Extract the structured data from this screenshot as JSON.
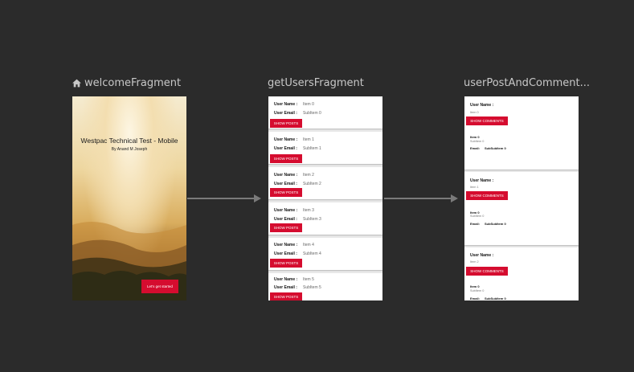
{
  "fragments": [
    {
      "title": "welcomeFragment"
    },
    {
      "title": "getUsersFragment"
    },
    {
      "title": "userPostAndComment..."
    }
  ],
  "welcome": {
    "title": "Westpac Technical Test - Mobile",
    "subtitle": "By Anand M Joseph",
    "button": "Let's get started"
  },
  "users": {
    "name_label": "User Name :",
    "email_label": "User Email :",
    "button": "SHOW POSTS",
    "items": [
      {
        "name": "Item 0",
        "email": "SubItem 0"
      },
      {
        "name": "Item 1",
        "email": "SubItem 1"
      },
      {
        "name": "Item 2",
        "email": "SubItem 2"
      },
      {
        "name": "Item 3",
        "email": "SubItem 3"
      },
      {
        "name": "Item 4",
        "email": "SubItem 4"
      },
      {
        "name": "Item 5",
        "email": "SubItem 5"
      }
    ]
  },
  "posts": {
    "name_label": "User Name :",
    "button": "SHOW COMMENTS",
    "email_label": "Email:",
    "items": [
      {
        "user": "Item 0",
        "title": "Item 0",
        "sub": "SubItem 0",
        "email": "SubSubItem 0"
      },
      {
        "user": "Item 1",
        "title": "Item 0",
        "sub": "SubItem 0",
        "email": "SubSubItem 0"
      },
      {
        "user": "Item 2",
        "title": "Item 0",
        "sub": "SubItem 0",
        "email": "SubSubItem 0"
      }
    ]
  },
  "colors": {
    "accent": "#d50c2f",
    "background": "#2b2b2b",
    "arrow": "#7a7a7a"
  }
}
